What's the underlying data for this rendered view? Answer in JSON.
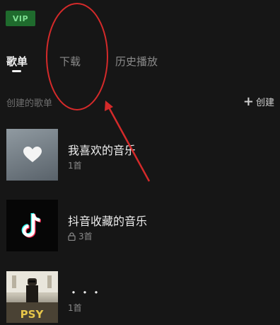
{
  "badge": {
    "vip": "VIP"
  },
  "tabs": [
    {
      "label": "歌单",
      "active": true
    },
    {
      "label": "下载",
      "active": false
    },
    {
      "label": "历史播放",
      "active": false
    }
  ],
  "section": {
    "title": "创建的歌单",
    "create_label": "创建"
  },
  "playlists": [
    {
      "title": "我喜欢的音乐",
      "count": "1首",
      "icon": "heart-icon"
    },
    {
      "title": "抖音收藏的音乐",
      "count": "3首",
      "icon": "lock-icon"
    },
    {
      "title": "・・・",
      "count": "1首"
    }
  ],
  "annotation_color": "#d42a2a"
}
